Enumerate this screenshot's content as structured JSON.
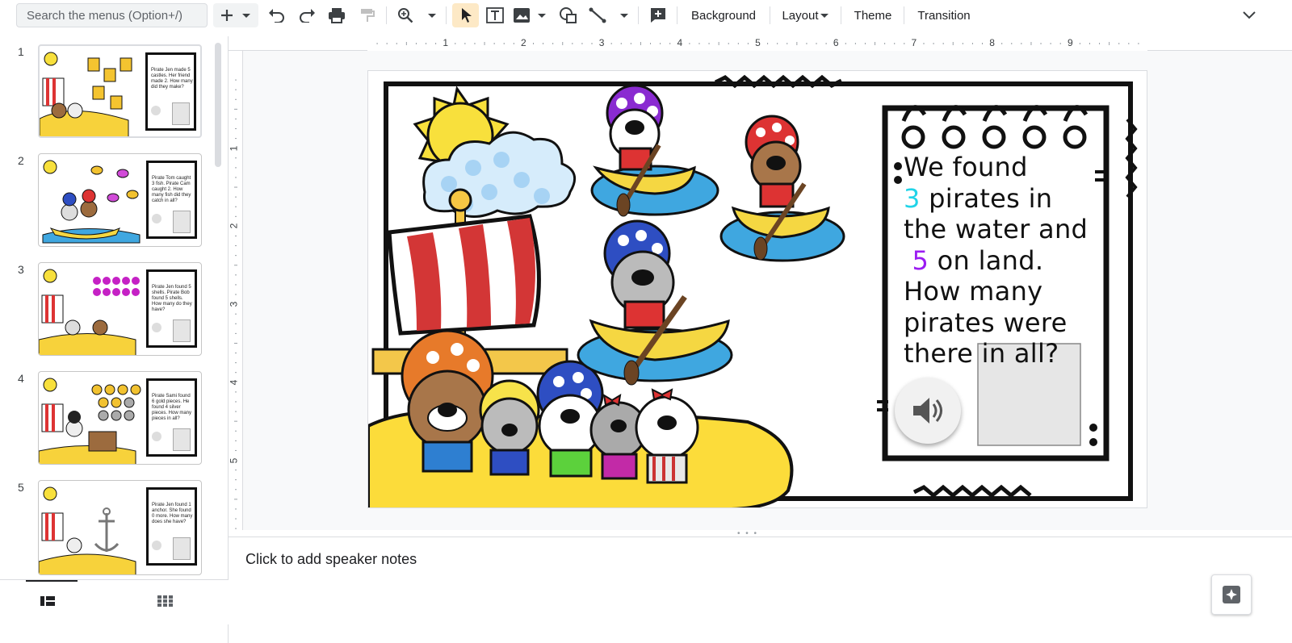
{
  "toolbar": {
    "search_placeholder": "Search the menus (Option+/)",
    "background": "Background",
    "layout": "Layout",
    "theme": "Theme",
    "transition": "Transition"
  },
  "ruler": {
    "top_labels": [
      "1",
      "2",
      "3",
      "4",
      "5",
      "6",
      "7",
      "8",
      "9"
    ],
    "left_labels": [
      "1",
      "2",
      "3",
      "4",
      "5"
    ]
  },
  "thumbnails": [
    {
      "number": "1",
      "text": "Pirate Jen made 5 castles. Her friend made 2. How many did they make?"
    },
    {
      "number": "2",
      "text": "Pirate Tom caught 3 fish. Pirate Cam caught 2. How many fish did they catch in all?"
    },
    {
      "number": "3",
      "text": "Pirate Jen found 5 shells. Pirate Bob found 5 shells. How many do they have?"
    },
    {
      "number": "4",
      "text": "Pirate Sami found 6 gold pieces. He found 4 silver pieces. How many pieces in all?"
    },
    {
      "number": "5",
      "text": "Pirate Jen found 1 anchor. She found 0 more. How many does she have?"
    }
  ],
  "slide": {
    "text_before": "We found",
    "num1": "3",
    "text_mid": "pirates in the water and",
    "num2": "5",
    "text_after": "on land. How many pirates were there in all?"
  },
  "notes": {
    "placeholder": "Click to add speaker notes"
  },
  "colors": {
    "accent_cyan": "#20d4e8",
    "accent_purple": "#9b1cf2",
    "selected_tool": "#fde9c6"
  }
}
